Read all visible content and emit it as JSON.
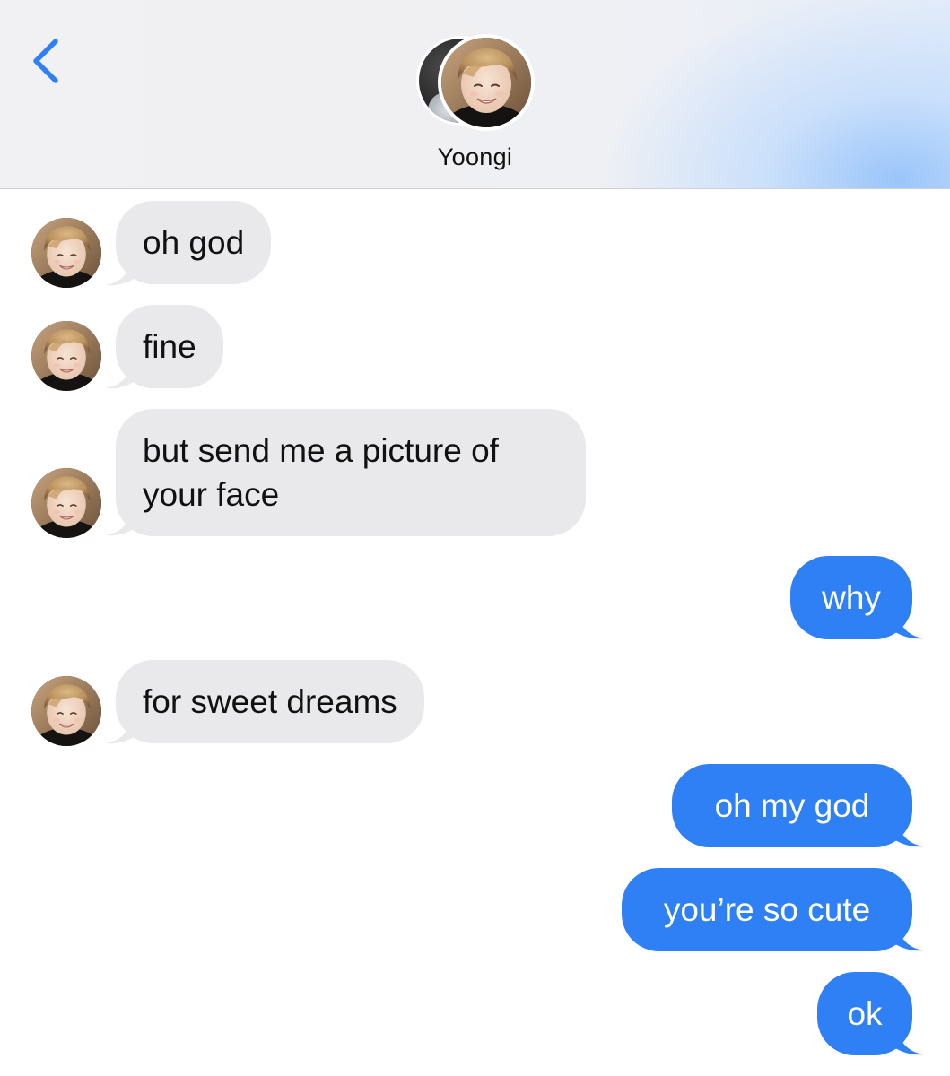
{
  "header": {
    "back_icon": "chevron-left-icon",
    "contact_name": "Yoongi"
  },
  "colors": {
    "incoming_bubble": "#e9e9eb",
    "outgoing_bubble": "#2f7ff5",
    "accent_blue": "#2f7ff5",
    "incoming_text": "#111111",
    "outgoing_text": "#ffffff"
  },
  "messages": [
    {
      "direction": "incoming",
      "text": "oh god"
    },
    {
      "direction": "incoming",
      "text": "fine"
    },
    {
      "direction": "incoming",
      "text_lines": [
        "but send me a picture of",
        "your face"
      ]
    },
    {
      "direction": "outgoing",
      "text": "why"
    },
    {
      "direction": "incoming",
      "text": "for sweet dreams"
    },
    {
      "direction": "outgoing",
      "text": "oh my god"
    },
    {
      "direction": "outgoing",
      "text": "you’re so cute"
    },
    {
      "direction": "outgoing",
      "text": "ok"
    }
  ]
}
